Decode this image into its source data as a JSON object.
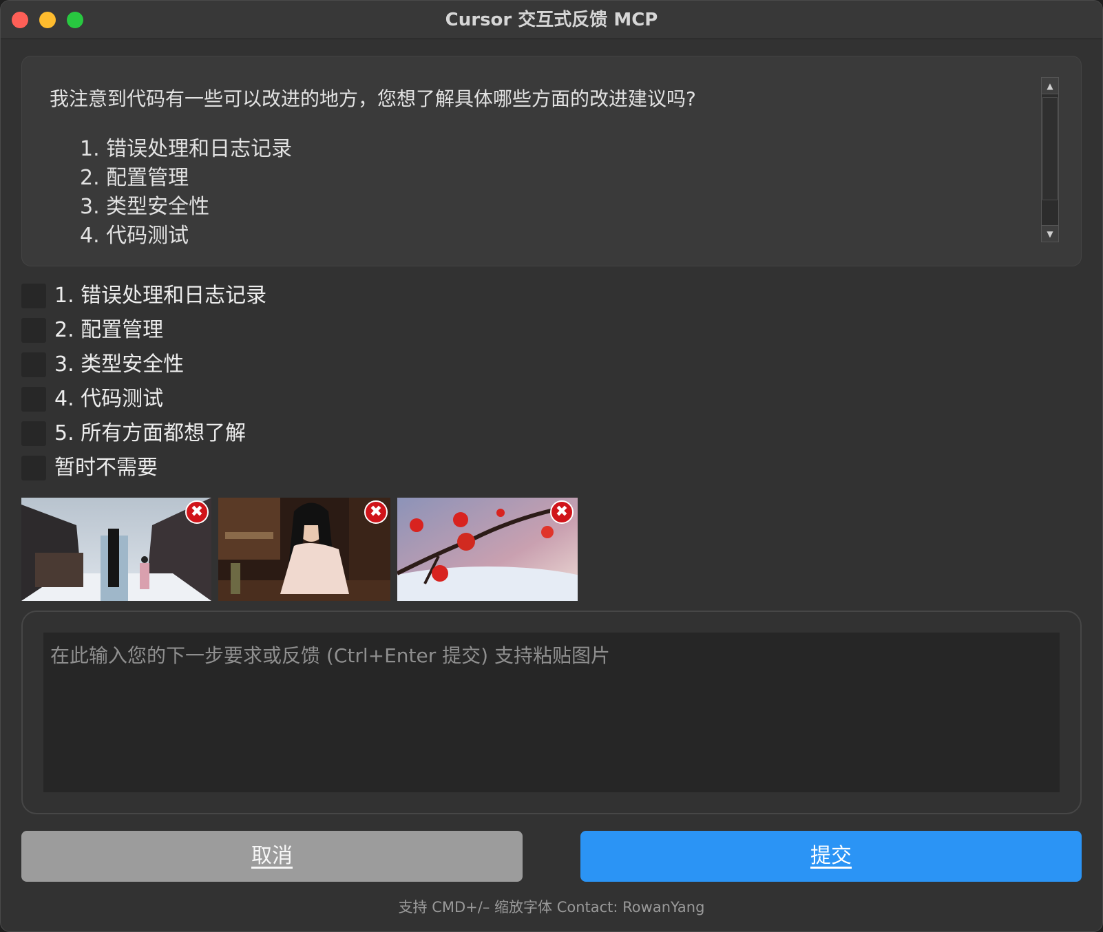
{
  "window": {
    "title": "Cursor 交互式反馈 MCP"
  },
  "message": {
    "text": "我注意到代码有一些可以改进的地方，您想了解具体哪些方面的改进建议吗?",
    "items": [
      "1. 错误处理和日志记录",
      "2. 配置管理",
      "3. 类型安全性",
      "4. 代码测试"
    ]
  },
  "options": [
    {
      "label": "1. 错误处理和日志记录",
      "checked": false
    },
    {
      "label": "2. 配置管理",
      "checked": false
    },
    {
      "label": "3. 类型安全性",
      "checked": false
    },
    {
      "label": "4. 代码测试",
      "checked": false
    },
    {
      "label": "5. 所有方面都想了解",
      "checked": false
    },
    {
      "label": "暂时不需要",
      "checked": false
    }
  ],
  "attachments": {
    "remove_glyph": "✖",
    "items": [
      {
        "subject": "snowy-ancient-street"
      },
      {
        "subject": "woman-writing"
      },
      {
        "subject": "plum-blossom-snow"
      }
    ]
  },
  "feedback": {
    "value": "",
    "placeholder": "在此输入您的下一步要求或反馈 (Ctrl+Enter 提交) 支持粘贴图片"
  },
  "buttons": {
    "cancel": "取消",
    "submit": "提交"
  },
  "footer": "支持 CMD+/– 缩放字体  Contact: RowanYang",
  "colors": {
    "window_bg": "#323232",
    "panel_bg": "#3a3a3a",
    "input_bg": "#262626",
    "cancel_bg": "#9c9c9c",
    "submit_bg": "#2b94f5",
    "remove_red": "#d0141a"
  },
  "icons": {
    "scroll_up": "▲",
    "scroll_down": "▼",
    "close_window": "traffic-light-close",
    "minimize_window": "traffic-light-minimize",
    "maximize_window": "traffic-light-maximize"
  }
}
